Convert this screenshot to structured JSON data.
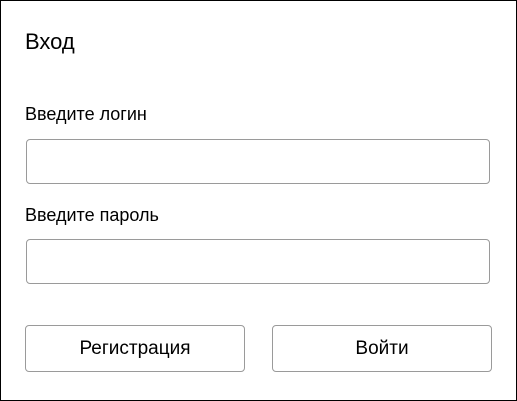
{
  "form": {
    "title": "Вход",
    "login_label": "Введите логин",
    "login_value": "",
    "password_label": "Введите пароль",
    "password_value": "",
    "register_button": "Регистрация",
    "login_button": "Войти"
  },
  "colors": {
    "border": "#000000",
    "input_border": "#9a9a9a",
    "background": "#ffffff",
    "text": "#000000"
  }
}
